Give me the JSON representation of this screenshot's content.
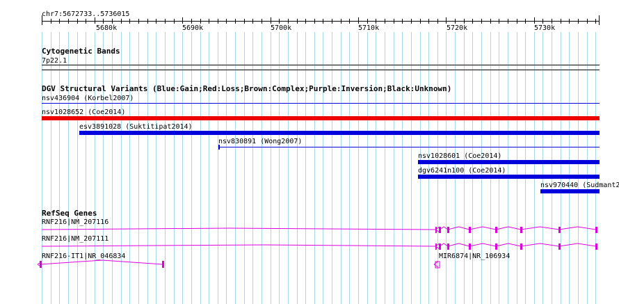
{
  "region": "chr7:5672733..5736015",
  "ruler": {
    "ticks": [
      "5680k",
      "5690k",
      "5700k",
      "5710k",
      "5720k",
      "5730k"
    ]
  },
  "tracks": {
    "cytoband": {
      "title": "Cytogenetic Bands",
      "band": "7p22.1"
    },
    "dgv": {
      "title": "DGV Structural Variants (Blue:Gain;Red:Loss;Brown:Complex;Purple:Inversion;Black:Unknown)",
      "colors": {
        "gain": "#0000dd",
        "loss": "#ee0000"
      },
      "items": [
        {
          "label": "nsv436904 (Korbel2007)",
          "type": "gain"
        },
        {
          "label": "nsv1028652 (Coe2014)",
          "type": "loss"
        },
        {
          "label": "esv3891028 (Suktitipat2014)",
          "type": "gain"
        },
        {
          "label": "nsv830891 (Wong2007)",
          "type": "gain"
        },
        {
          "label": "nsv1028601 (Coe2014)",
          "type": "gain"
        },
        {
          "label": "dgv6241n100 (Coe2014)",
          "type": "gain"
        },
        {
          "label": "nsv970440 (Sudmant2",
          "type": "gain"
        }
      ]
    },
    "refseq": {
      "title": "RefSeq Genes",
      "color": "#dd00dd",
      "genes": [
        {
          "label": "RNF216|NM_207116"
        },
        {
          "label": "RNF216|NM_207111"
        },
        {
          "label": "RNF216-IT1|NR_046834"
        },
        {
          "label": "MIR6874|NR_106934"
        }
      ]
    }
  },
  "colors": {
    "grid": "#a8d8e8",
    "text": "#000000"
  }
}
